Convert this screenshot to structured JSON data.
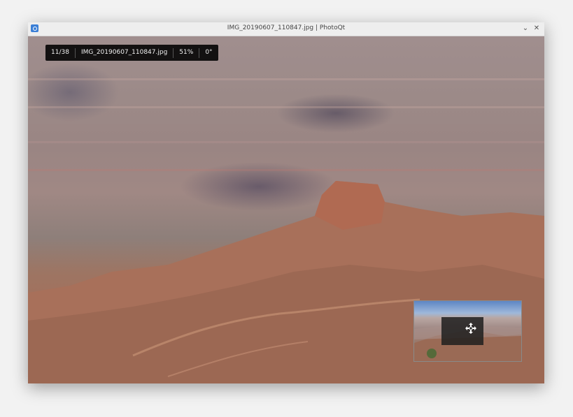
{
  "window": {
    "title": "IMG_20190607_110847.jpg | PhotoQt",
    "minimize_glyph": "⌄",
    "close_glyph": "✕"
  },
  "info_bar": {
    "position": "11/38",
    "filename": "IMG_20190607_110847.jpg",
    "zoom": "51%",
    "rotation": "0°"
  },
  "minimap": {
    "icon": "move-icon"
  },
  "colors": {
    "titlebar": "#eeeeee",
    "info_bg": "#000000",
    "accent": "#3b7fd6"
  }
}
